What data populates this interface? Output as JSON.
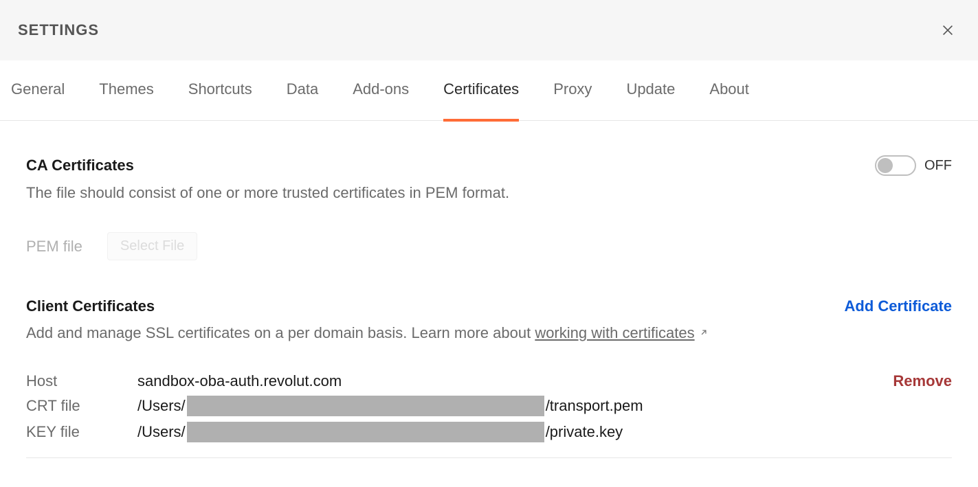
{
  "header": {
    "title": "SETTINGS"
  },
  "tabs": [
    {
      "label": "General",
      "active": false
    },
    {
      "label": "Themes",
      "active": false
    },
    {
      "label": "Shortcuts",
      "active": false
    },
    {
      "label": "Data",
      "active": false
    },
    {
      "label": "Add-ons",
      "active": false
    },
    {
      "label": "Certificates",
      "active": true
    },
    {
      "label": "Proxy",
      "active": false
    },
    {
      "label": "Update",
      "active": false
    },
    {
      "label": "About",
      "active": false
    }
  ],
  "ca": {
    "title": "CA Certificates",
    "desc": "The file should consist of one or more trusted certificates in PEM format.",
    "pem_label": "PEM file",
    "select_button": "Select File",
    "toggle_state": "OFF"
  },
  "client": {
    "title": "Client Certificates",
    "add_label": "Add Certificate",
    "desc_prefix": "Add and manage SSL certificates on a per domain basis. Learn more about ",
    "desc_link": "working with certificates",
    "entries": [
      {
        "host_label": "Host",
        "host_value": "sandbox-oba-auth.revolut.com",
        "crt_label": "CRT file",
        "crt_prefix": "/Users/",
        "crt_suffix": "/transport.pem",
        "key_label": "KEY file",
        "key_prefix": "/Users/",
        "key_suffix": "/private.key",
        "remove_label": "Remove"
      }
    ]
  }
}
